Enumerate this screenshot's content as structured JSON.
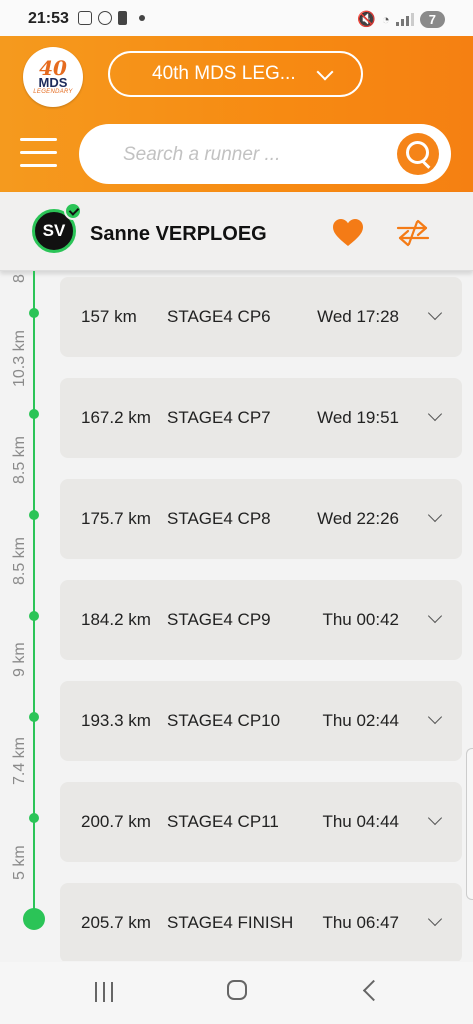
{
  "status_bar": {
    "time": "21:53",
    "battery_level": "7"
  },
  "header": {
    "logo": {
      "number": "40",
      "text": "MDS",
      "sub": "LEGENDARY"
    },
    "race_selector": "40th MDS LEG...",
    "search": {
      "placeholder": "Search a runner ..."
    }
  },
  "runner": {
    "initials": "SV",
    "name": "Sanne VERPLOEG"
  },
  "timeline": {
    "top_partial_label": "8",
    "segments": [
      "10.3 km",
      "8.5 km",
      "8.5 km",
      "9 km",
      "7.4 km",
      "5 km"
    ],
    "checkpoints": [
      {
        "distance": "157 km",
        "name": "STAGE4 CP6",
        "time": "Wed 17:28"
      },
      {
        "distance": "167.2 km",
        "name": "STAGE4 CP7",
        "time": "Wed 19:51"
      },
      {
        "distance": "175.7 km",
        "name": "STAGE4 CP8",
        "time": "Wed 22:26"
      },
      {
        "distance": "184.2 km",
        "name": "STAGE4 CP9",
        "time": "Thu 00:42"
      },
      {
        "distance": "193.3 km",
        "name": "STAGE4 CP10",
        "time": "Thu 02:44"
      },
      {
        "distance": "200.7 km",
        "name": "STAGE4 CP11",
        "time": "Thu 04:44"
      },
      {
        "distance": "205.7 km",
        "name": "STAGE4 FINISH",
        "time": "Thu 06:47"
      }
    ]
  },
  "colors": {
    "brand_orange": "#f78a12",
    "progress_green": "#2bc457",
    "card_bg": "#e9e8e6"
  }
}
